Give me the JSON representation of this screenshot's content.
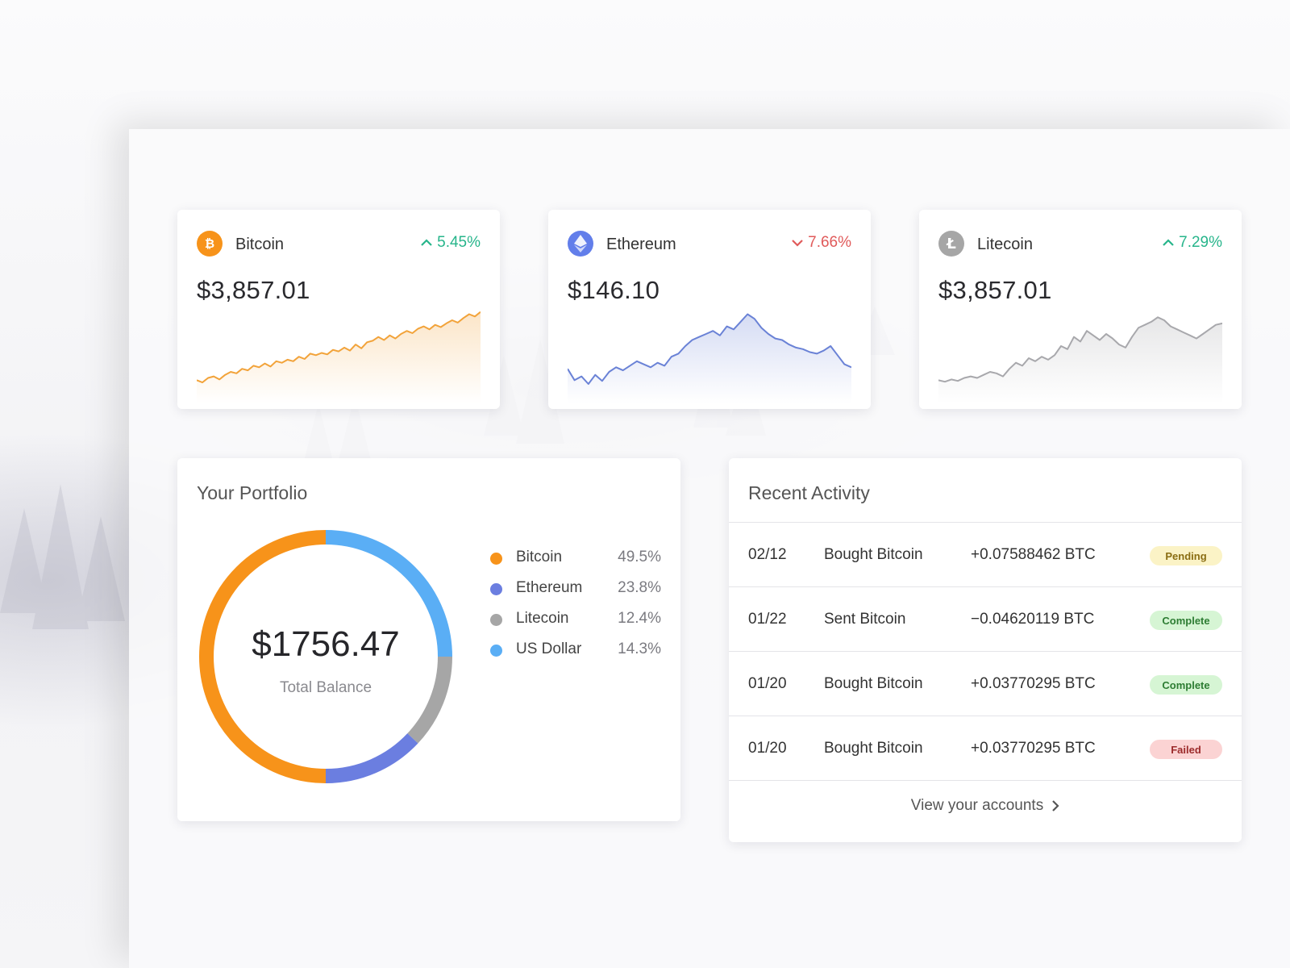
{
  "colors": {
    "bitcoin": "#f7931a",
    "ethereum": "#6b7ee0",
    "litecoin": "#a6a6a6",
    "usd": "#5aaef5",
    "up": "#27b58b",
    "down": "#e05a5a"
  },
  "price_cards": [
    {
      "name": "Bitcoin",
      "price": "$3,857.01",
      "change": "5.45%",
      "direction": "up",
      "icon": "bitcoin-icon",
      "color": "#f2a33a",
      "trend": [
        0.05,
        0.02,
        0.08,
        0.1,
        0.06,
        0.12,
        0.16,
        0.14,
        0.2,
        0.18,
        0.24,
        0.22,
        0.27,
        0.23,
        0.3,
        0.28,
        0.32,
        0.3,
        0.36,
        0.33,
        0.4,
        0.38,
        0.41,
        0.39,
        0.45,
        0.43,
        0.48,
        0.44,
        0.52,
        0.47,
        0.55,
        0.57,
        0.62,
        0.58,
        0.64,
        0.6,
        0.66,
        0.7,
        0.67,
        0.73,
        0.76,
        0.72,
        0.78,
        0.75,
        0.8,
        0.84,
        0.81,
        0.87,
        0.92,
        0.89,
        0.95
      ]
    },
    {
      "name": "Ethereum",
      "price": "$146.10",
      "change": "7.66%",
      "direction": "down",
      "icon": "ethereum-icon",
      "color": "#6a82d6",
      "trend": [
        0.2,
        0.05,
        0.1,
        0.0,
        0.12,
        0.04,
        0.16,
        0.22,
        0.18,
        0.24,
        0.3,
        0.26,
        0.22,
        0.28,
        0.24,
        0.36,
        0.4,
        0.5,
        0.58,
        0.62,
        0.66,
        0.7,
        0.64,
        0.76,
        0.72,
        0.82,
        0.92,
        0.86,
        0.74,
        0.66,
        0.6,
        0.58,
        0.52,
        0.48,
        0.46,
        0.42,
        0.4,
        0.44,
        0.5,
        0.38,
        0.26,
        0.22
      ]
    },
    {
      "name": "Litecoin",
      "price": "$3,857.01",
      "change": "7.29%",
      "direction": "up",
      "icon": "litecoin-icon",
      "color": "#a8a8ac",
      "trend": [
        0.05,
        0.03,
        0.06,
        0.04,
        0.08,
        0.1,
        0.08,
        0.12,
        0.16,
        0.14,
        0.1,
        0.2,
        0.28,
        0.24,
        0.34,
        0.3,
        0.36,
        0.32,
        0.38,
        0.5,
        0.46,
        0.62,
        0.56,
        0.7,
        0.64,
        0.58,
        0.66,
        0.6,
        0.52,
        0.48,
        0.62,
        0.74,
        0.78,
        0.82,
        0.88,
        0.84,
        0.76,
        0.72,
        0.68,
        0.64,
        0.6,
        0.66,
        0.72,
        0.78,
        0.8
      ]
    }
  ],
  "portfolio": {
    "title": "Your Portfolio",
    "total_amount": "$1756.47",
    "total_label": "Total Balance",
    "legend": [
      {
        "name": "Bitcoin",
        "pct": "49.5%",
        "color": "#f7931a"
      },
      {
        "name": "Ethereum",
        "pct": "23.8%",
        "color": "#6b7ee0"
      },
      {
        "name": "Litecoin",
        "pct": "12.4%",
        "color": "#a6a6a6"
      },
      {
        "name": "US Dollar",
        "pct": "14.3%",
        "color": "#5aaef5"
      }
    ]
  },
  "chart_data": {
    "type": "pie",
    "categories": [
      "US Dollar",
      "Litecoin",
      "Ethereum",
      "Bitcoin"
    ],
    "values": [
      25,
      12,
      13,
      50
    ]
  },
  "activity": {
    "title": "Recent Activity",
    "rows": [
      {
        "date": "02/12",
        "desc": "Bought Bitcoin",
        "amount": "+0.07588462 BTC",
        "status": "Pending",
        "status_type": "pending"
      },
      {
        "date": "01/22",
        "desc": "Sent Bitcoin",
        "amount": "−0.04620119 BTC",
        "status": "Complete",
        "status_type": "complete"
      },
      {
        "date": "01/20",
        "desc": "Bought Bitcoin",
        "amount": "+0.03770295 BTC",
        "status": "Complete",
        "status_type": "complete"
      },
      {
        "date": "01/20",
        "desc": "Bought Bitcoin",
        "amount": "+0.03770295 BTC",
        "status": "Failed",
        "status_type": "failed"
      }
    ],
    "view_link": "View your accounts"
  }
}
